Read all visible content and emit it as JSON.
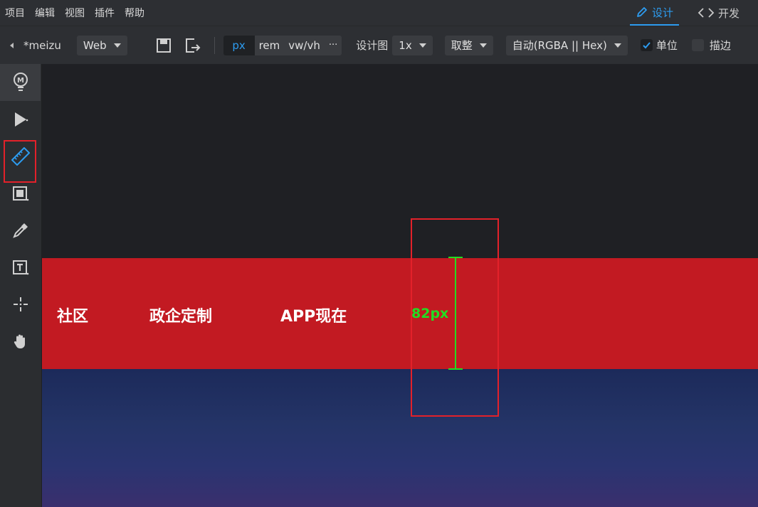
{
  "menubar": {
    "items": [
      "项目",
      "编辑",
      "视图",
      "插件",
      "帮助"
    ],
    "mode_design": "设计",
    "mode_dev": "开发"
  },
  "toolbar": {
    "project_name": "*meizu",
    "platform": "Web",
    "units": [
      "px",
      "rem",
      "vw/vh",
      "···"
    ],
    "active_unit": "px",
    "design_label": "设计图",
    "scale": "1x",
    "rounding": "取整",
    "color_format": "自动(RGBA || Hex)",
    "unit_check_label": "单位",
    "unit_checked": true,
    "outline_label": "描边",
    "outline_checked": false
  },
  "sidebar": {
    "tools": [
      "logo-icon",
      "pointer-icon",
      "ruler-icon",
      "frame-icon",
      "eyedropper-icon",
      "text-icon",
      "crosshair-icon",
      "hand-icon"
    ],
    "active_tool": "ruler-icon"
  },
  "canvas": {
    "nav_links": [
      "社区",
      "政企定制",
      "APP现在"
    ],
    "measure_value": "82px"
  },
  "colors": {
    "accent": "#2d9cf0",
    "nav_red": "#c21a22",
    "measure": "#22dd22",
    "highlight": "#e3212a"
  }
}
